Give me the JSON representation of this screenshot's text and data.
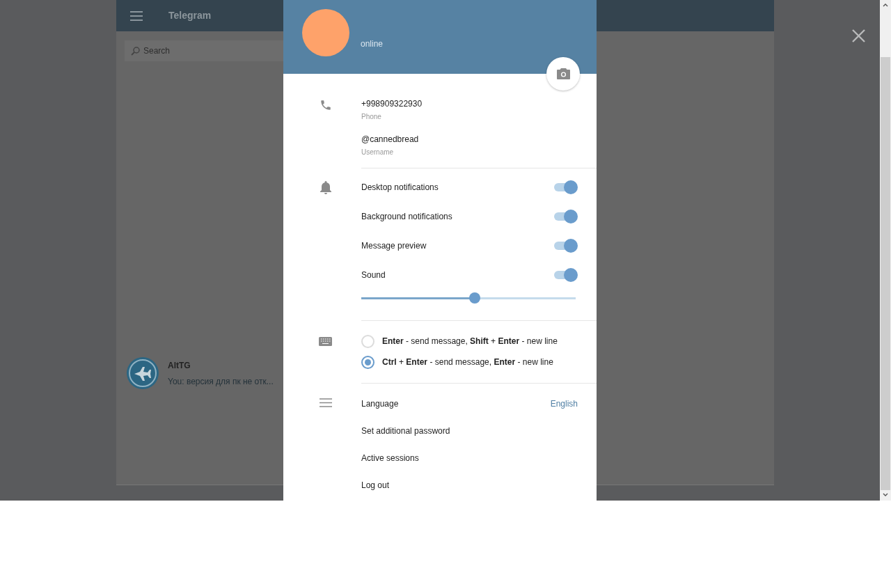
{
  "background_app": {
    "title": "Telegram",
    "search": {
      "placeholder": "Search"
    },
    "chats": [
      {
        "name": "AltTG",
        "preview": "You: версия для пк не отк..."
      }
    ]
  },
  "profile": {
    "status": "online"
  },
  "contact": [
    {
      "value": "+998909322930",
      "label": "Phone"
    },
    {
      "value": "@cannedbread",
      "label": "Username"
    }
  ],
  "notifications": {
    "toggles": [
      {
        "label": "Desktop notifications",
        "on": true
      },
      {
        "label": "Background notifications",
        "on": true
      },
      {
        "label": "Message preview",
        "on": true
      },
      {
        "label": "Sound",
        "on": true
      }
    ],
    "volume": {
      "level": 0.53
    }
  },
  "send_mode": {
    "options": [
      {
        "text": "**Enter** - send message, **Shift** + **Enter** - new line",
        "selected": false
      },
      {
        "text": "**Ctrl** + **Enter** - send message, **Enter** - new line",
        "selected": true
      }
    ]
  },
  "links": [
    {
      "label": "Language",
      "value": "English"
    },
    {
      "label": "Set additional password"
    },
    {
      "label": "Active sessions"
    },
    {
      "label": "Log out"
    }
  ]
}
